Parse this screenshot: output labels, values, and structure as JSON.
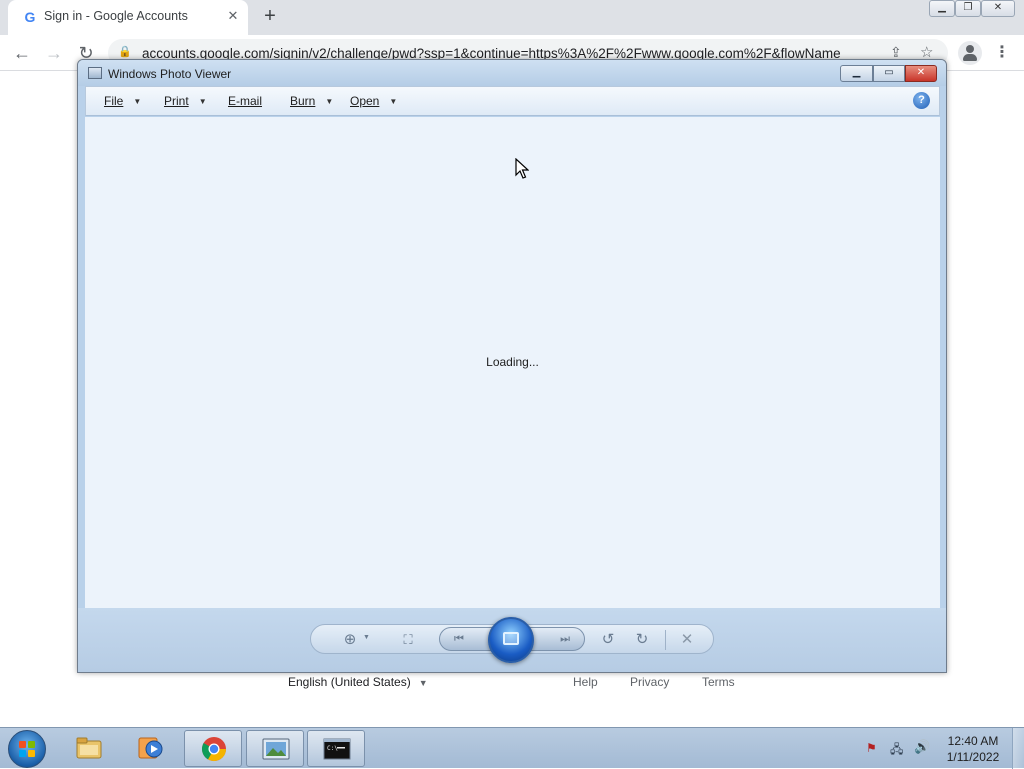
{
  "browser": {
    "tab_title": "Sign in - Google Accounts",
    "tab_logo": "G",
    "url": "accounts.google.com/signin/v2/challenge/pwd?ssp=1&continue=https%3A%2F%2Fwww.google.com%2F&flowName",
    "icons": [
      "back-icon",
      "forward-icon",
      "reload-icon",
      "lock-icon",
      "share-icon",
      "star-icon",
      "profile-icon",
      "menu-icon"
    ]
  },
  "google_footer": {
    "language": "English (United States)",
    "links": {
      "help": "Help",
      "privacy": "Privacy",
      "terms": "Terms"
    }
  },
  "photo_viewer": {
    "title": "Windows Photo Viewer",
    "menu": {
      "file": "File",
      "print": "Print",
      "email": "E-mail",
      "burn": "Burn",
      "open": "Open"
    },
    "status": "Loading...",
    "controls": [
      "zoom-icon",
      "fit-to-window-icon",
      "previous-icon",
      "slideshow-icon",
      "next-icon",
      "rotate-ccw-icon",
      "rotate-cw-icon",
      "delete-icon"
    ]
  },
  "taskbar": {
    "apps": [
      "windows-explorer",
      "windows-media-player",
      "google-chrome",
      "windows-photo-viewer",
      "command-prompt"
    ],
    "time": "12:40 AM",
    "date": "1/11/2022"
  }
}
